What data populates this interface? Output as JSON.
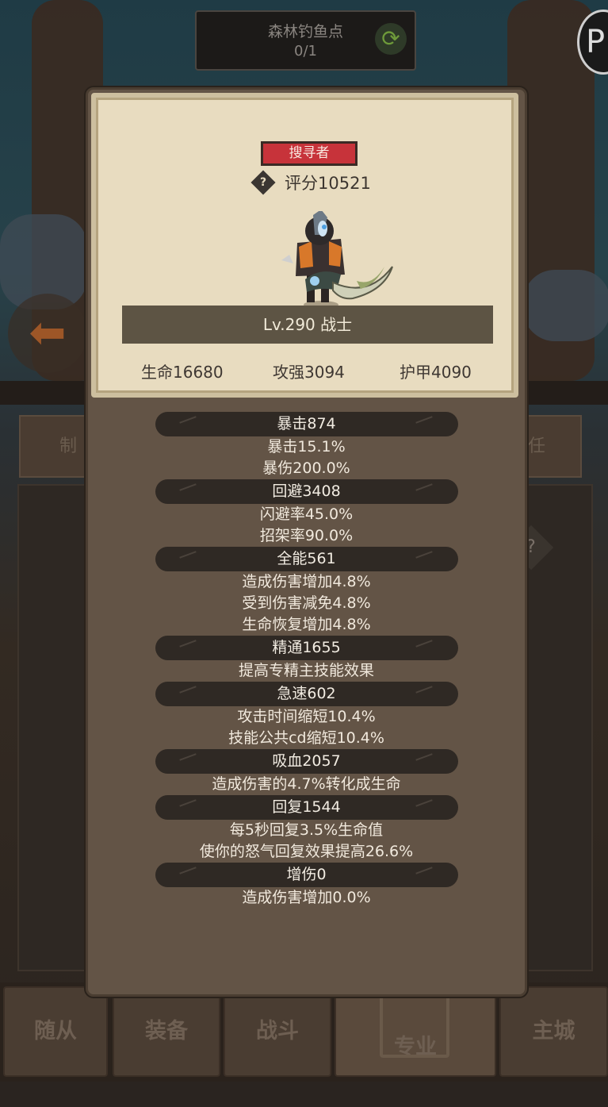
{
  "background": {
    "location_title": "森林钓鱼点",
    "location_count": "0/1",
    "side_tab_left": "制",
    "side_tab_right": "任",
    "question_mark": "?",
    "corner_badge": "P"
  },
  "bottom_nav": [
    {
      "label": "随从"
    },
    {
      "label": "装备"
    },
    {
      "label": "战斗"
    },
    {
      "label": "专业"
    },
    {
      "label": "主城"
    }
  ],
  "hero": {
    "class_badge": "搜寻者",
    "rating_label": "评分10521",
    "rating_icon": "?",
    "level_text": "Lv.290 战士",
    "stats": {
      "hp": "生命16680",
      "attack": "攻强3094",
      "armor": "护甲4090"
    }
  },
  "attributes": [
    {
      "header": "暴击874",
      "lines": [
        "暴击15.1%",
        "暴伤200.0%"
      ]
    },
    {
      "header": "回避3408",
      "lines": [
        "闪避率45.0%",
        "招架率90.0%"
      ]
    },
    {
      "header": "全能561",
      "lines": [
        "造成伤害增加4.8%",
        "受到伤害减免4.8%",
        "生命恢复增加4.8%"
      ]
    },
    {
      "header": "精通1655",
      "lines": [
        "提高专精主技能效果"
      ]
    },
    {
      "header": "急速602",
      "lines": [
        "攻击时间缩短10.4%",
        "技能公共cd缩短10.4%"
      ]
    },
    {
      "header": "吸血2057",
      "lines": [
        "造成伤害的4.7%转化成生命"
      ]
    },
    {
      "header": "回复1544",
      "lines": [
        "每5秒回复3.5%生命值",
        "使你的怒气回复效果提高26.6%"
      ]
    },
    {
      "header": "增伤0",
      "lines": [
        "造成伤害增加0.0%"
      ]
    }
  ]
}
